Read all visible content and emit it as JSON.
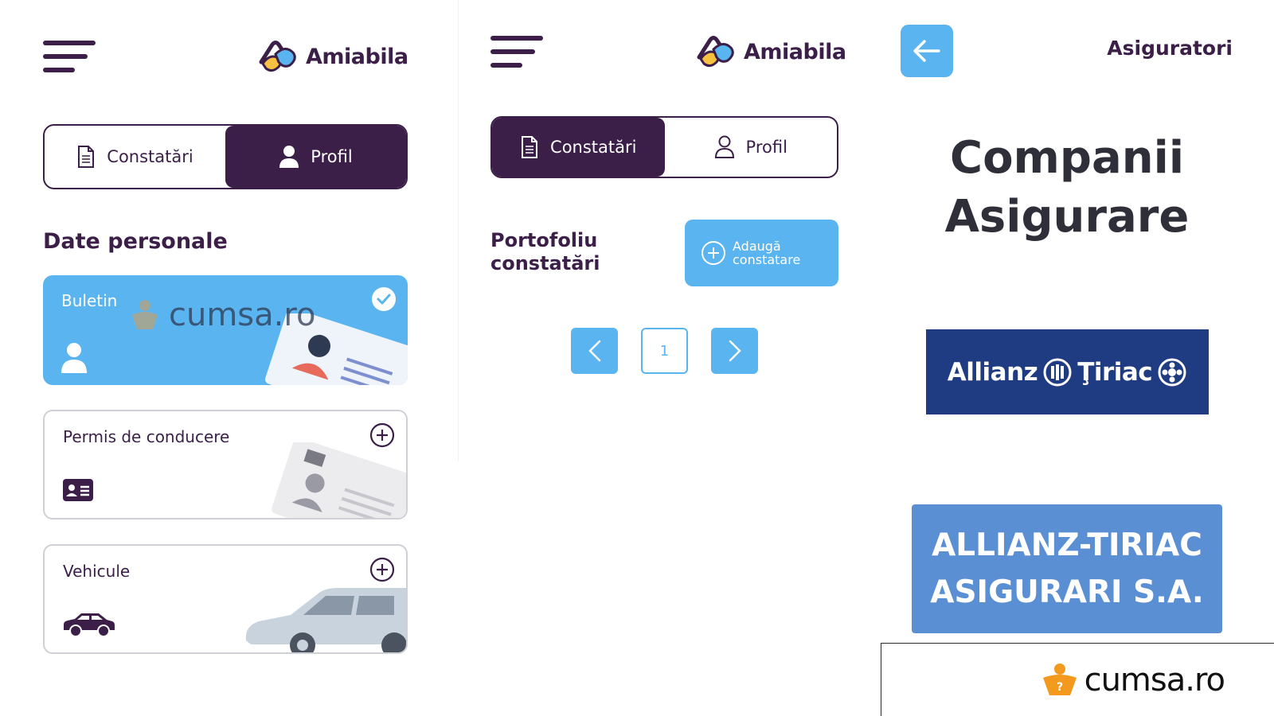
{
  "brand": {
    "name": "Amiabila"
  },
  "profile_screen": {
    "tabs": [
      {
        "label": "Constatări",
        "active": false
      },
      {
        "label": "Profil",
        "active": true
      }
    ],
    "section_title": "Date personale",
    "cards": [
      {
        "label": "Buletin",
        "state": "completed",
        "icon": "person-icon",
        "action_icon": "check-circle-icon"
      },
      {
        "label": "Permis de conducere",
        "state": "empty",
        "icon": "id-card-icon",
        "action_icon": "plus-circle-icon"
      },
      {
        "label": "Vehicule",
        "state": "empty",
        "icon": "car-icon",
        "action_icon": "plus-circle-icon"
      }
    ]
  },
  "reports_screen": {
    "tabs": [
      {
        "label": "Constatări",
        "active": true
      },
      {
        "label": "Profil",
        "active": false
      }
    ],
    "section_title": "Portofoliu constatări",
    "add_button_label": "Adaugă constatare",
    "pagination": {
      "current_page": "1"
    }
  },
  "insurers_screen": {
    "header_title": "Asiguratori",
    "title_line1": "Companii",
    "title_line2": "Asigurare",
    "logo_text_left": "Allianz",
    "logo_text_right": "Ţiriac",
    "insurer_name_line1": "ALLIANZ-TIRIAC",
    "insurer_name_line2": "ASIGURARI S.A."
  },
  "watermark": {
    "text": "cumsa.ro"
  },
  "colors": {
    "primary_dark": "#3b1f49",
    "accent_blue": "#5ab4f0",
    "allianz_blue": "#1f3b82",
    "insurer_card": "#5b8fd4",
    "logo_yellow": "#f6c140",
    "logo_blue": "#5ab4f0"
  }
}
